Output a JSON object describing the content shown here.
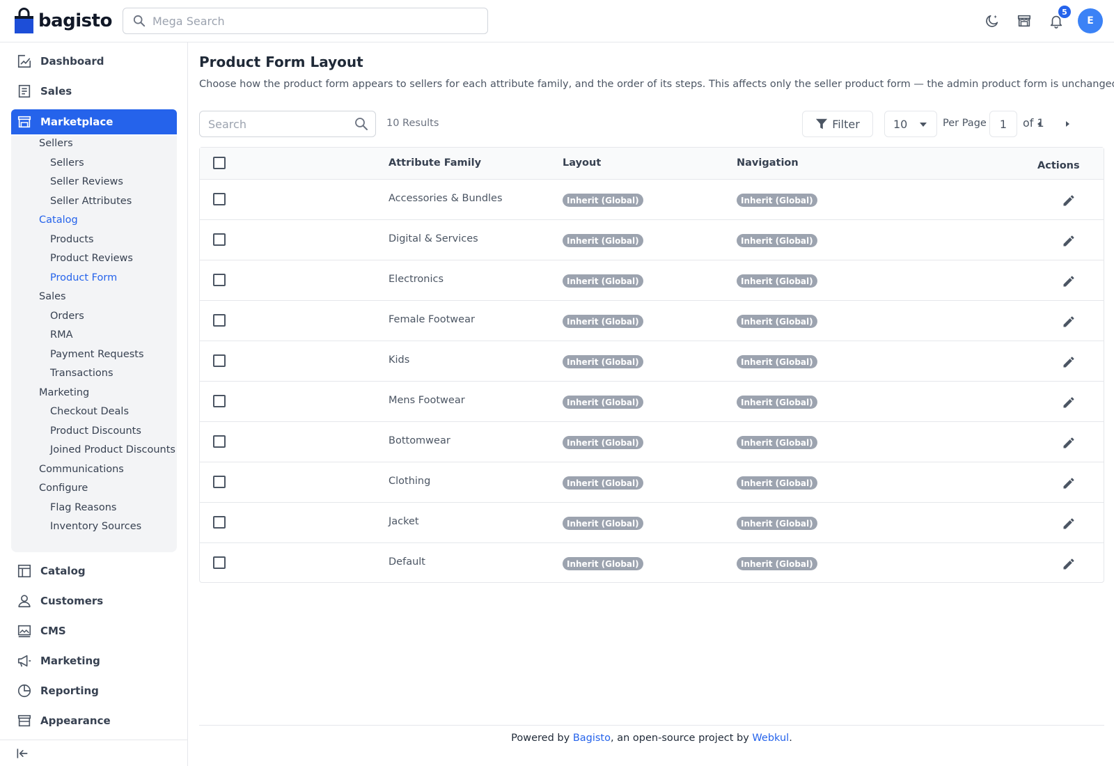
{
  "header": {
    "brand": "bagisto",
    "search_placeholder": "Mega Search",
    "notification_count": "5",
    "avatar_initial": "E"
  },
  "sidebar": {
    "items": [
      {
        "label": "Dashboard",
        "icon": "dashboard-icon"
      },
      {
        "label": "Sales",
        "icon": "receipt-icon"
      },
      {
        "label": "Marketplace",
        "icon": "store-icon",
        "active": true
      },
      {
        "label": "Catalog",
        "icon": "catalog-icon"
      },
      {
        "label": "Customers",
        "icon": "user-icon"
      },
      {
        "label": "CMS",
        "icon": "image-icon"
      },
      {
        "label": "Marketing",
        "icon": "megaphone-icon"
      },
      {
        "label": "Reporting",
        "icon": "pie-chart-icon"
      },
      {
        "label": "Appearance",
        "icon": "storefront-icon"
      }
    ],
    "submenu": [
      {
        "label": "Sellers",
        "level": 1
      },
      {
        "label": "Sellers",
        "level": 2
      },
      {
        "label": "Seller Reviews",
        "level": 2
      },
      {
        "label": "Seller Attributes",
        "level": 2
      },
      {
        "label": "Catalog",
        "level": 1,
        "highlight": true
      },
      {
        "label": "Products",
        "level": 2
      },
      {
        "label": "Product Reviews",
        "level": 2
      },
      {
        "label": "Product Form",
        "level": 2,
        "highlight": true
      },
      {
        "label": "Sales",
        "level": 1
      },
      {
        "label": "Orders",
        "level": 2
      },
      {
        "label": "RMA",
        "level": 2
      },
      {
        "label": "Payment Requests",
        "level": 2
      },
      {
        "label": "Transactions",
        "level": 2
      },
      {
        "label": "Marketing",
        "level": 1
      },
      {
        "label": "Checkout Deals",
        "level": 2
      },
      {
        "label": "Product Discounts",
        "level": 2
      },
      {
        "label": "Joined Product Discounts",
        "level": 2
      },
      {
        "label": "Communications",
        "level": 1
      },
      {
        "label": "Configure",
        "level": 1
      },
      {
        "label": "Flag Reasons",
        "level": 2
      },
      {
        "label": "Inventory Sources",
        "level": 2
      }
    ]
  },
  "page": {
    "title": "Product Form Layout",
    "description": "Choose how the product form appears to sellers for each attribute family, and the order of its steps. This affects only the seller product form — the admin product form is unchanged."
  },
  "toolbar": {
    "search_placeholder": "Search",
    "results": "10 Results",
    "filter_label": "Filter",
    "per_page_value": "10",
    "per_page_label": "Per Page",
    "page_value": "1",
    "of_label": "of 1"
  },
  "table": {
    "columns": [
      "Attribute Family",
      "Layout",
      "Navigation",
      "Actions"
    ],
    "rows": [
      {
        "family": "Accessories & Bundles",
        "layout": "Inherit (Global)",
        "navigation": "Inherit (Global)"
      },
      {
        "family": "Digital & Services",
        "layout": "Inherit (Global)",
        "navigation": "Inherit (Global)"
      },
      {
        "family": "Electronics",
        "layout": "Inherit (Global)",
        "navigation": "Inherit (Global)"
      },
      {
        "family": "Female Footwear",
        "layout": "Inherit (Global)",
        "navigation": "Inherit (Global)"
      },
      {
        "family": "Kids",
        "layout": "Inherit (Global)",
        "navigation": "Inherit (Global)"
      },
      {
        "family": "Mens Footwear",
        "layout": "Inherit (Global)",
        "navigation": "Inherit (Global)"
      },
      {
        "family": "Bottomwear",
        "layout": "Inherit (Global)",
        "navigation": "Inherit (Global)"
      },
      {
        "family": "Clothing",
        "layout": "Inherit (Global)",
        "navigation": "Inherit (Global)"
      },
      {
        "family": "Jacket",
        "layout": "Inherit (Global)",
        "navigation": "Inherit (Global)"
      },
      {
        "family": "Default",
        "layout": "Inherit (Global)",
        "navigation": "Inherit (Global)"
      }
    ]
  },
  "footer": {
    "prefix": "Powered by ",
    "link1": "Bagisto",
    "middle": ", an open-source project by ",
    "link2": "Webkul",
    "suffix": "."
  },
  "colors": {
    "accent": "#2563eb",
    "badge": "#9ca3af",
    "submenu_bg": "#f3f4f6"
  }
}
